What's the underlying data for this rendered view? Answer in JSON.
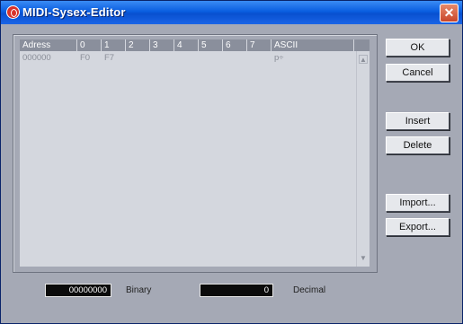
{
  "window": {
    "title": "MIDI-Sysex-Editor",
    "close_label": "✕"
  },
  "table": {
    "columns": [
      "Adress",
      "0",
      "1",
      "2",
      "3",
      "4",
      "5",
      "6",
      "7",
      "ASCII"
    ],
    "rows": [
      {
        "address": "000000",
        "b0": "F0",
        "b1": "F7",
        "ascii": "p÷"
      }
    ]
  },
  "buttons": {
    "ok": "OK",
    "cancel": "Cancel",
    "insert": "Insert",
    "delete": "Delete",
    "import": "Import...",
    "export": "Export..."
  },
  "fields": {
    "binary_value": "00000000",
    "binary_label": "Binary",
    "decimal_value": "0",
    "decimal_label": "Decimal"
  },
  "icons": {
    "app": "app-logo-icon",
    "close": "close-icon"
  }
}
